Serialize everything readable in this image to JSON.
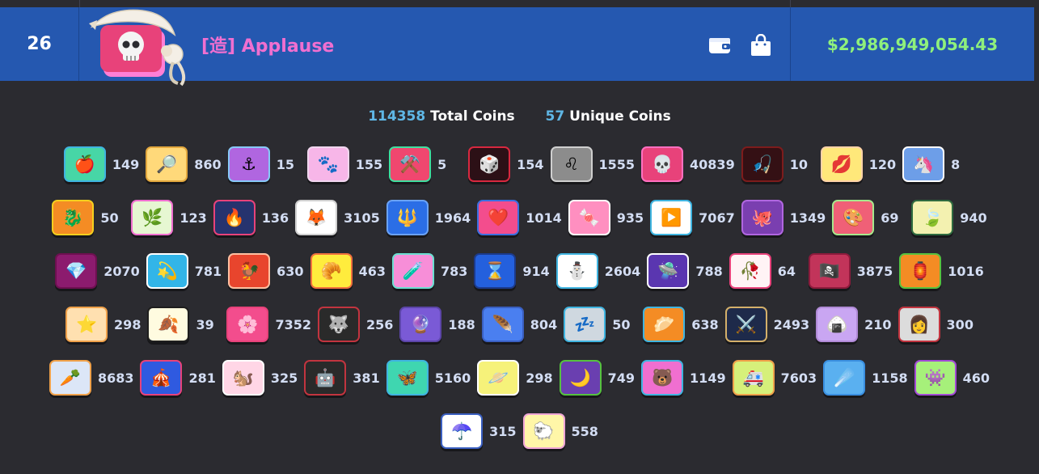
{
  "leaderboard_row": {
    "rank": "26",
    "player_name": "[造] Applause",
    "balance": "$2,986,949,054.43",
    "icons": [
      "wallet-icon",
      "shopping-bag-icon"
    ]
  },
  "summary": {
    "total_value": "114358",
    "total_label": "Total Coins",
    "unique_value": "57",
    "unique_label": "Unique Coins"
  },
  "coins": [
    {
      "emoji": "🍎",
      "count": "149",
      "bg": "#47d6a6",
      "border": "#3fb4e0"
    },
    {
      "emoji": "🔎",
      "count": "860",
      "bg": "#ffd97a",
      "border": "#e3a83e"
    },
    {
      "emoji": "⚓",
      "count": "15",
      "bg": "#b066e0",
      "border": "#87c9f7"
    },
    {
      "emoji": "🐾",
      "count": "155",
      "bg": "#f7b6e8",
      "border": "#f0d6ee"
    },
    {
      "emoji": "⚒️",
      "count": "5",
      "bg": "#f0476f",
      "border": "#3fdf9f"
    },
    {
      "emoji": "🎲",
      "count": "154",
      "bg": "#2c1016",
      "border": "#d8283f"
    },
    {
      "emoji": "♌",
      "count": "1555",
      "bg": "#8c8c8c",
      "border": "#cfcfcf"
    },
    {
      "emoji": "💀",
      "count": "40839",
      "bg": "#e8427a",
      "border": "#ff6fc0"
    },
    {
      "emoji": "🎣",
      "count": "10",
      "bg": "#341014",
      "border": "#7d1c1c"
    },
    {
      "emoji": "💋",
      "count": "120",
      "bg": "#ffe87a",
      "border": "#ffd3a8"
    },
    {
      "emoji": "🦄",
      "count": "8",
      "bg": "#6d9ee8",
      "border": "#ffffff"
    },
    {
      "emoji": "🐉",
      "count": "50",
      "bg": "#f48c24",
      "border": "#f4cf1e"
    },
    {
      "emoji": "🌿",
      "count": "123",
      "bg": "#e6f7d2",
      "border": "#f06fd0"
    },
    {
      "emoji": "🔥",
      "count": "136",
      "bg": "#26336e",
      "border": "#e8427a"
    },
    {
      "emoji": "🦊",
      "count": "3105",
      "bg": "#ffffff",
      "border": "#cfcfcf"
    },
    {
      "emoji": "🔱",
      "count": "1964",
      "bg": "#2b6ee6",
      "border": "#6aa2f5"
    },
    {
      "emoji": "❤️",
      "count": "1014",
      "bg": "#f34d8d",
      "border": "#3a6fe0"
    },
    {
      "emoji": "🍬",
      "count": "935",
      "bg": "#ff8fc0",
      "border": "#ffffff"
    },
    {
      "emoji": "▶️",
      "count": "7067",
      "bg": "#ffffff",
      "border": "#3fb4e0"
    },
    {
      "emoji": "🐙",
      "count": "1349",
      "bg": "#7a3fb0",
      "border": "#b066e0"
    },
    {
      "emoji": "🎨",
      "count": "69",
      "bg": "#f06077",
      "border": "#a6e88c"
    },
    {
      "emoji": "🍃",
      "count": "940",
      "bg": "#f3f1b0",
      "border": "#2f6b40"
    },
    {
      "emoji": "💎",
      "count": "2070",
      "bg": "#8c1b6e",
      "border": "#6d1050"
    },
    {
      "emoji": "💫",
      "count": "781",
      "bg": "#32b5e8",
      "border": "#ffffff"
    },
    {
      "emoji": "🐓",
      "count": "630",
      "bg": "#e8452d",
      "border": "#ffbfa0"
    },
    {
      "emoji": "🥐",
      "count": "463",
      "bg": "#ffec3d",
      "border": "#f06f3d"
    },
    {
      "emoji": "🧪",
      "count": "783",
      "bg": "#f78ed8",
      "border": "#6adfd0"
    },
    {
      "emoji": "⌛",
      "count": "914",
      "bg": "#2460dd",
      "border": "#1c3a8a"
    },
    {
      "emoji": "⛄",
      "count": "2604",
      "bg": "#ffffff",
      "border": "#3fb4e0"
    },
    {
      "emoji": "🛸",
      "count": "788",
      "bg": "#5a36b0",
      "border": "#ffffff"
    },
    {
      "emoji": "🥀",
      "count": "64",
      "bg": "#fff3f5",
      "border": "#e8427a"
    },
    {
      "emoji": "🏴‍☠️",
      "count": "3875",
      "bg": "#c2345a",
      "border": "#8c1b3c"
    },
    {
      "emoji": "🏮",
      "count": "1016",
      "bg": "#f48c24",
      "border": "#56c23f"
    },
    {
      "emoji": "⭐",
      "count": "298",
      "bg": "#ffe0b0",
      "border": "#f0a14a"
    },
    {
      "emoji": "🍂",
      "count": "39",
      "bg": "#fffbe0",
      "border": "#1e1e1e"
    },
    {
      "emoji": "🌸",
      "count": "7352",
      "bg": "#f34d8d",
      "border": "#e8427a"
    },
    {
      "emoji": "🐺",
      "count": "256",
      "bg": "#2a2a2a",
      "border": "#c2343f"
    },
    {
      "emoji": "🔮",
      "count": "188",
      "bg": "#7a5ad6",
      "border": "#5c45a8"
    },
    {
      "emoji": "🪶",
      "count": "804",
      "bg": "#4a7ff0",
      "border": "#3a5fc0"
    },
    {
      "emoji": "💤",
      "count": "50",
      "bg": "#cfd8e0",
      "border": "#3fb4e0"
    },
    {
      "emoji": "🥟",
      "count": "638",
      "bg": "#f48c24",
      "border": "#3fb4e0"
    },
    {
      "emoji": "⚔️",
      "count": "2493",
      "bg": "#1e2a4a",
      "border": "#d4b06a"
    },
    {
      "emoji": "🍙",
      "count": "210",
      "bg": "#c9a6f2",
      "border": "#b08ad6"
    },
    {
      "emoji": "👩",
      "count": "300",
      "bg": "#dcdcdc",
      "border": "#c2343f"
    },
    {
      "emoji": "🥕",
      "count": "8683",
      "bg": "#dce6f7",
      "border": "#f0a14a"
    },
    {
      "emoji": "🎪",
      "count": "281",
      "bg": "#2f5ae0",
      "border": "#e8427a"
    },
    {
      "emoji": "🐿️",
      "count": "325",
      "bg": "#ffd6e6",
      "border": "#ffffff"
    },
    {
      "emoji": "🤖",
      "count": "381",
      "bg": "#2a2a2a",
      "border": "#c2343f"
    },
    {
      "emoji": "🦋",
      "count": "5160",
      "bg": "#3fd6b0",
      "border": "#3fb4e0"
    },
    {
      "emoji": "🪐",
      "count": "298",
      "bg": "#f6f27a",
      "border": "#ffffff"
    },
    {
      "emoji": "🌙",
      "count": "749",
      "bg": "#6a3fb0",
      "border": "#56c23f"
    },
    {
      "emoji": "🐻",
      "count": "1149",
      "bg": "#f06fd0",
      "border": "#3fb4e0"
    },
    {
      "emoji": "🚑",
      "count": "7603",
      "bg": "#d6f07a",
      "border": "#f0a14a"
    },
    {
      "emoji": "☄️",
      "count": "1158",
      "bg": "#5ab0f0",
      "border": "#3a8fe0"
    },
    {
      "emoji": "👾",
      "count": "460",
      "bg": "#a6f07a",
      "border": "#a24ad6"
    },
    {
      "emoji": "☂️",
      "count": "315",
      "bg": "#ffffff",
      "border": "#3a5fc0"
    },
    {
      "emoji": "🐑",
      "count": "558",
      "bg": "#fff6a8",
      "border": "#f0a6d6"
    }
  ],
  "colors": {
    "row_bg": "#2558b0",
    "page_bg": "#2b2b30",
    "name": "#f06fd0",
    "money": "#8ff07c",
    "summary_number": "#5fb7e6"
  }
}
